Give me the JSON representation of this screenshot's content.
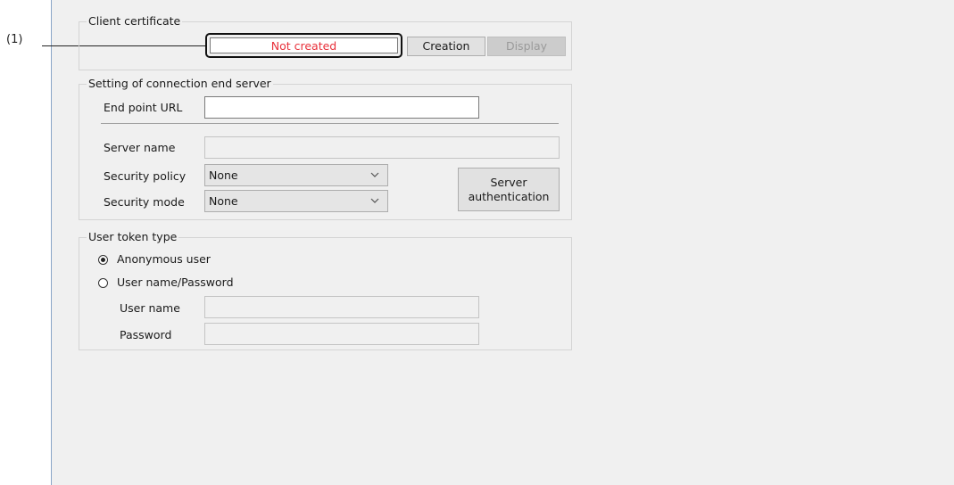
{
  "callout": {
    "number": "(1)"
  },
  "client_certificate": {
    "legend": "Client certificate",
    "status": "Not created",
    "status_color": "#e8303a",
    "creation_button": "Creation",
    "display_button": "Display"
  },
  "connection": {
    "legend": "Setting of connection end server",
    "endpoint_label": "End point URL",
    "endpoint_value": "",
    "server_name_label": "Server name",
    "server_name_value": "",
    "security_policy_label": "Security policy",
    "security_policy_value": "None",
    "security_mode_label": "Security mode",
    "security_mode_value": "None",
    "server_auth_button": "Server\nauthentication"
  },
  "user_token": {
    "legend": "User token type",
    "anonymous_label": "Anonymous user",
    "anonymous_selected": true,
    "username_password_label": "User name/Password",
    "username_label": "User name",
    "password_label": "Password"
  }
}
